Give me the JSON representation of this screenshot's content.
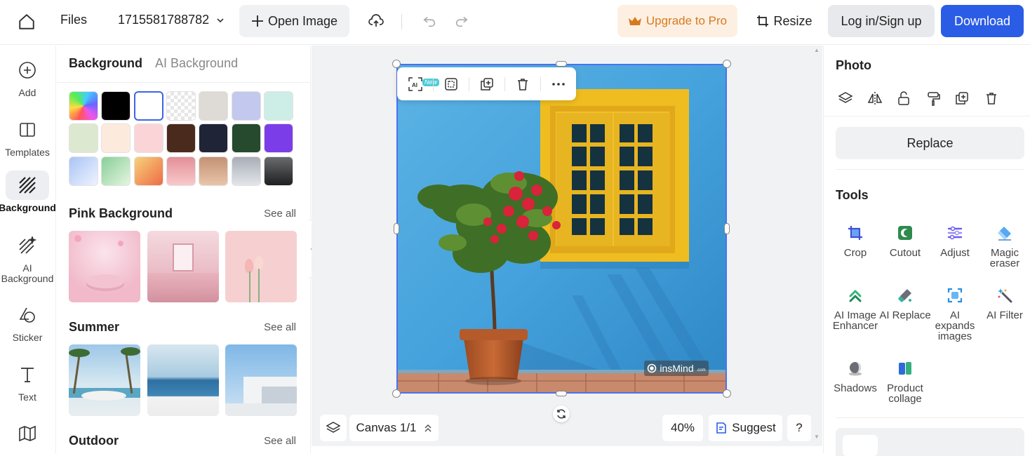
{
  "topbar": {
    "files_label": "Files",
    "file_name": "1715581788782",
    "open_image_label": "Open Image",
    "upgrade_label": "Upgrade to Pro",
    "resize_label": "Resize",
    "login_label": "Log in/Sign up",
    "download_label": "Download",
    "colors": {
      "download_bg": "#2b5ce6",
      "upgrade_text": "#d77a1f",
      "upgrade_bg": "#fdf0e2"
    }
  },
  "rail": {
    "items": [
      {
        "label": "Add",
        "icon": "plus-circle-icon"
      },
      {
        "label": "Templates",
        "icon": "templates-icon"
      },
      {
        "label": "Background",
        "icon": "background-hatch-icon",
        "active": true
      },
      {
        "label": "AI Background",
        "icon": "ai-background-icon"
      },
      {
        "label": "Sticker",
        "icon": "sticker-icon"
      },
      {
        "label": "Text",
        "icon": "text-icon"
      },
      {
        "label": "",
        "icon": "map-icon"
      }
    ]
  },
  "bg_panel": {
    "tab_active": "Background",
    "tab_other": "AI Background",
    "swatches": [
      "rainbow",
      "#000000",
      "#ffffff",
      "transparent",
      "#dedad6",
      "#c3c8ee",
      "#cdeee6",
      "#dce9d0",
      "#fcebdd",
      "#fbd4d7",
      "#4a2a1c",
      "#1f2536",
      "#254a2e",
      "#7b3de8",
      "grad-blue",
      "grad-green",
      "grad-orange",
      "grad-pink",
      "grad-tan",
      "grad-silver",
      "grad-dark"
    ],
    "sections": [
      {
        "title": "Pink Background",
        "see_all": "See all"
      },
      {
        "title": "Summer",
        "see_all": "See all"
      },
      {
        "title": "Outdoor",
        "see_all": "See all"
      }
    ]
  },
  "canvas": {
    "new_badge": "New",
    "watermark": "insMind",
    "watermark_suffix": ".com",
    "canvas_label": "Canvas 1/1",
    "zoom": "40%",
    "suggest_label": "Suggest",
    "help_label": "?"
  },
  "right_panel": {
    "photo_title": "Photo",
    "replace_label": "Replace",
    "tools_title": "Tools",
    "tools": [
      {
        "label": "Crop",
        "icon": "crop-icon"
      },
      {
        "label": "Cutout",
        "icon": "cutout-icon"
      },
      {
        "label": "Adjust",
        "icon": "adjust-icon"
      },
      {
        "label": "Magic eraser",
        "icon": "magic-eraser-icon"
      },
      {
        "label": "AI Image Enhancer",
        "icon": "ai-enhancer-icon"
      },
      {
        "label": "AI Replace",
        "icon": "ai-replace-icon"
      },
      {
        "label": "AI expands images",
        "icon": "ai-expand-icon"
      },
      {
        "label": "AI Filter",
        "icon": "ai-filter-icon"
      },
      {
        "label": "Shadows",
        "icon": "shadows-icon"
      },
      {
        "label": "Product collage",
        "icon": "product-collage-icon"
      }
    ]
  }
}
